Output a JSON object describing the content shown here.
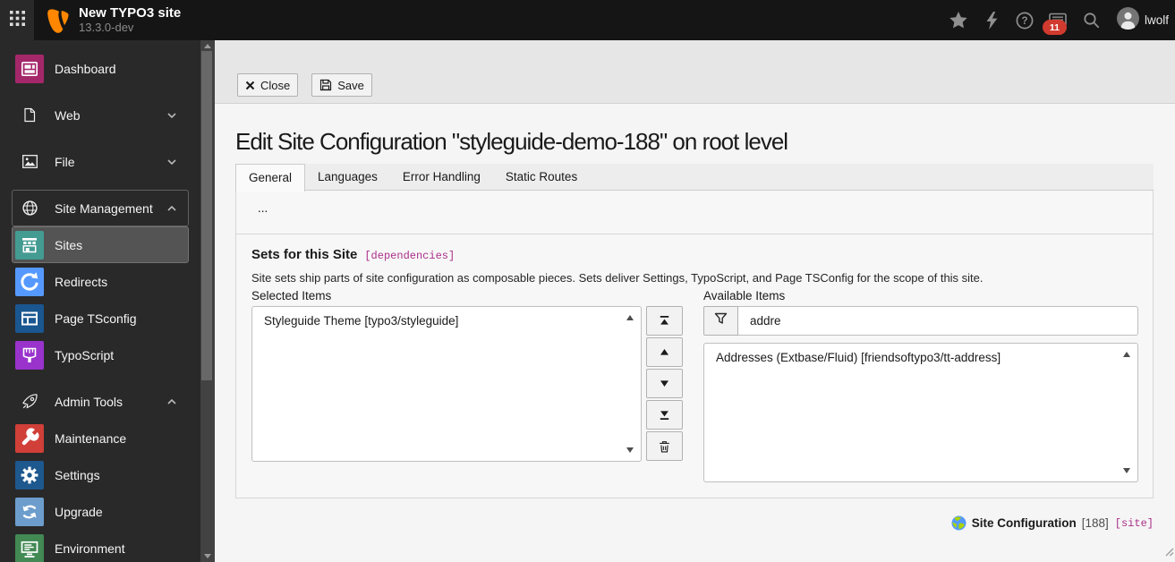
{
  "topbar": {
    "title": "New TYPO3 site",
    "version": "13.3.0-dev",
    "tools": [
      "star",
      "bolt",
      "help",
      "systeminformation",
      "search"
    ],
    "badge_count": "11",
    "username": "lwolf"
  },
  "sidebar": {
    "groups": [
      {
        "items": [
          {
            "label": "Dashboard",
            "icon": "m-dashboard",
            "type": "module",
            "color": "#a4276a"
          }
        ]
      },
      {
        "items": [
          {
            "label": "Web",
            "icon": "doc",
            "type": "header",
            "chevron": "down"
          }
        ]
      },
      {
        "items": [
          {
            "label": "File",
            "icon": "image",
            "type": "header",
            "chevron": "down"
          }
        ]
      },
      {
        "items": [
          {
            "label": "Site Management",
            "icon": "globe",
            "type": "header",
            "chevron": "up",
            "state": "boxed"
          },
          {
            "label": "Sites",
            "icon": "m-sites",
            "type": "module",
            "color": "#439b92",
            "state": "active"
          },
          {
            "label": "Redirects",
            "icon": "m-redirects",
            "type": "module",
            "color": "#5599ff"
          },
          {
            "label": "Page TSconfig",
            "icon": "m-ptsconfig",
            "type": "module",
            "color": "#1a568f"
          },
          {
            "label": "TypoScript",
            "icon": "m-typoscript",
            "type": "module",
            "color": "#9933cc"
          }
        ]
      },
      {
        "items": [
          {
            "label": "Admin Tools",
            "icon": "rocket",
            "type": "header",
            "chevron": "up"
          },
          {
            "label": "Maintenance",
            "icon": "m-maintenance",
            "type": "module",
            "color": "#d03f38"
          },
          {
            "label": "Settings",
            "icon": "m-settings",
            "type": "module",
            "color": "#1d588e"
          },
          {
            "label": "Upgrade",
            "icon": "m-upgrade",
            "type": "module",
            "color": "#6c9dcc"
          },
          {
            "label": "Environment",
            "icon": "m-environment",
            "type": "module",
            "color": "#428954"
          }
        ]
      }
    ]
  },
  "docheader": {
    "close_label": "Close",
    "save_label": "Save"
  },
  "main": {
    "title": "Edit Site Configuration \"styleguide-demo-188\" on root level",
    "tabs": [
      "General",
      "Languages",
      "Error Handling",
      "Static Routes"
    ],
    "active_tab": 0,
    "placeholder": "...",
    "section": {
      "title": "Sets for this Site",
      "flag": "[dependencies]",
      "description": "Site sets ship parts of site configuration as composable pieces. Sets deliver Settings, TypoScript, and Page TSConfig for the scope of this site.",
      "selected_label": "Selected Items",
      "available_label": "Available Items",
      "selected_items": [
        "Styleguide Theme [typo3/styleguide]"
      ],
      "filter_value": "addre",
      "available_items": [
        "Addresses (Extbase/Fluid) [friendsoftypo3/tt-address]"
      ],
      "movers": [
        "move-to-top",
        "move-up",
        "move-down",
        "move-to-bottom",
        "delete"
      ]
    },
    "footer": {
      "record": "Site Configuration",
      "uid": "[188]",
      "table": "[site]"
    }
  }
}
